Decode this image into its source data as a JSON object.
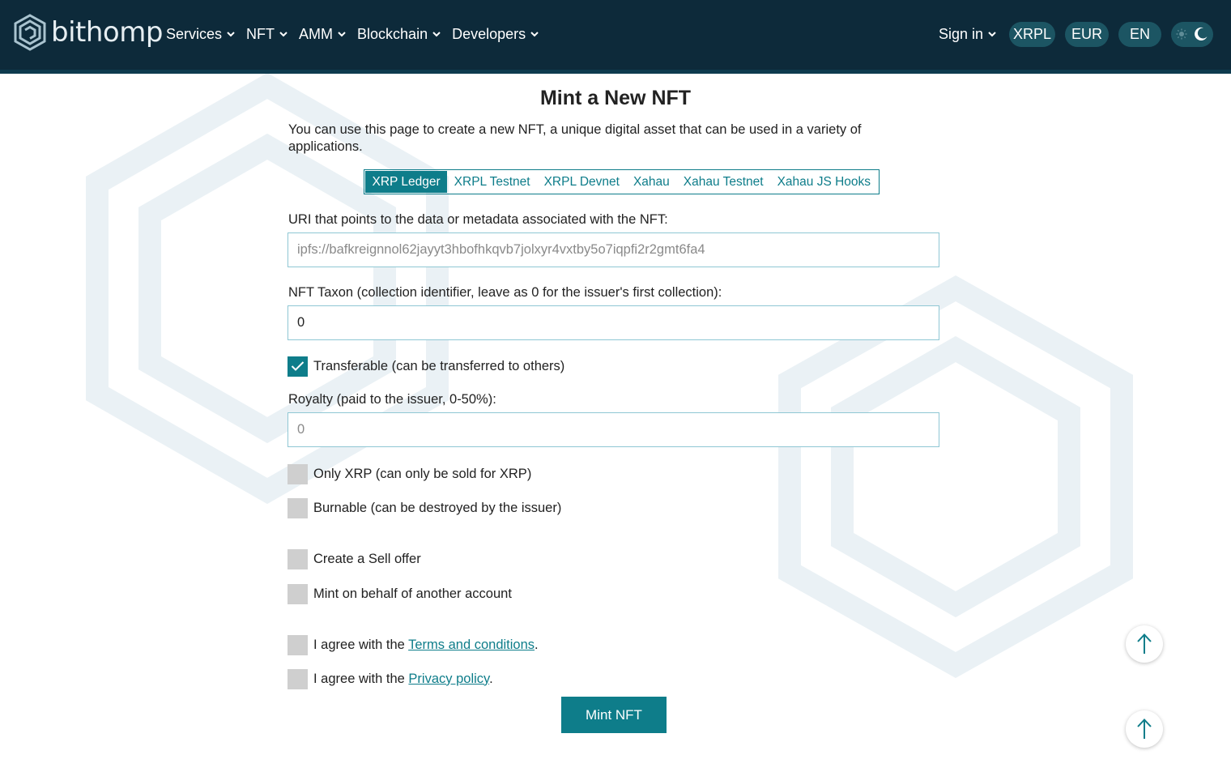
{
  "brand": {
    "name": "bithomp"
  },
  "nav": {
    "items": [
      {
        "label": "Services"
      },
      {
        "label": "NFT"
      },
      {
        "label": "AMM"
      },
      {
        "label": "Blockchain"
      },
      {
        "label": "Developers"
      }
    ],
    "sign_in": "Sign in",
    "network": "XRPL",
    "currency": "EUR",
    "language": "EN"
  },
  "page": {
    "title": "Mint a New NFT",
    "intro": "You can use this page to create a new NFT, a unique digital asset that can be used in a variety of applications."
  },
  "network_tabs": [
    {
      "label": "XRP Ledger",
      "active": true
    },
    {
      "label": "XRPL Testnet",
      "active": false
    },
    {
      "label": "XRPL Devnet",
      "active": false
    },
    {
      "label": "Xahau",
      "active": false
    },
    {
      "label": "Xahau Testnet",
      "active": false
    },
    {
      "label": "Xahau JS Hooks",
      "active": false
    }
  ],
  "form": {
    "uri_label": "URI that points to the data or metadata associated with the NFT:",
    "uri_placeholder": "ipfs://bafkreignnol62jayyt3hbofhkqvb7jolxyr4vxtby5o7iqpfi2r2gmt6fa4",
    "taxon_label": "NFT Taxon (collection identifier, leave as 0 for the issuer's first collection):",
    "taxon_value": "0",
    "transferable_label": "Transferable (can be transferred to others)",
    "transferable_checked": true,
    "royalty_label": "Royalty (paid to the issuer, 0-50%):",
    "royalty_placeholder": "0",
    "only_xrp_label": "Only XRP (can only be sold for XRP)",
    "burnable_label": "Burnable (can be destroyed by the issuer)",
    "sell_offer_label": "Create a Sell offer",
    "on_behalf_label": "Mint on behalf of another account",
    "agree_prefix": "I agree with the",
    "terms_link": "Terms and conditions",
    "privacy_link": "Privacy policy",
    "period": ".",
    "submit_label": "Mint NFT"
  },
  "colors": {
    "header_bg": "#0d2a3a",
    "accent": "#0e7d8a",
    "pill_bg": "#1c5563"
  },
  "icons": {
    "logo": "bithomp-hex-logo-icon",
    "chevron": "chevron-down-icon",
    "sun": "sun-icon",
    "moon": "moon-icon",
    "check": "check-icon",
    "arrow_up": "arrow-up-icon"
  }
}
